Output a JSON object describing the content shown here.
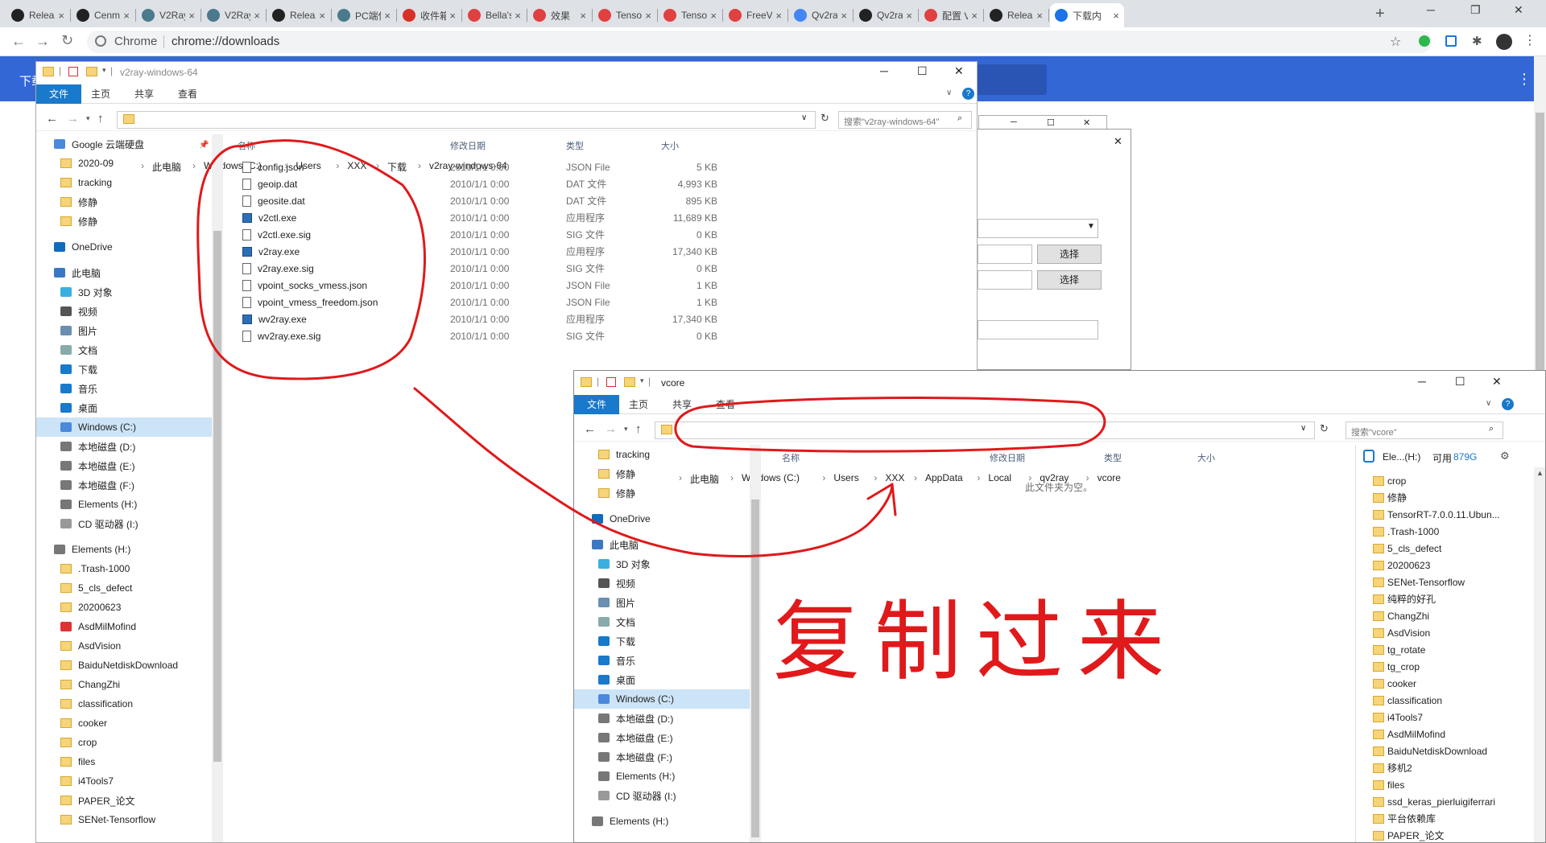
{
  "browser": {
    "tabs": [
      {
        "label": "Releas",
        "icon": "github-icon"
      },
      {
        "label": "Cenm",
        "icon": "github-icon"
      },
      {
        "label": "V2Ray",
        "icon": "page-icon"
      },
      {
        "label": "V2Ray",
        "icon": "page-icon"
      },
      {
        "label": "Releas",
        "icon": "github-icon"
      },
      {
        "label": "PC端使",
        "icon": "page-icon"
      },
      {
        "label": "收件箱",
        "icon": "gmail-icon"
      },
      {
        "label": "Bella's",
        "icon": "app-icon"
      },
      {
        "label": "效果",
        "icon": "app-icon"
      },
      {
        "label": "Tenso",
        "icon": "app-icon"
      },
      {
        "label": "Tenso",
        "icon": "app-icon"
      },
      {
        "label": "FreeV",
        "icon": "app-icon"
      },
      {
        "label": "Qv2ra",
        "icon": "google-icon"
      },
      {
        "label": "Qv2ra",
        "icon": "github-icon"
      },
      {
        "label": "配置 V",
        "icon": "app-icon"
      },
      {
        "label": "Relea",
        "icon": "github-icon"
      },
      {
        "label": "下载内",
        "icon": "download-icon",
        "active": true
      }
    ],
    "omnibox": {
      "site": "Chrome",
      "url": "chrome://downloads"
    }
  },
  "downloads_page": {
    "title": "下载"
  },
  "explorer1": {
    "title": "v2ray-windows-64",
    "ribbon": [
      "文件",
      "主页",
      "共享",
      "查看"
    ],
    "path": [
      "此电脑",
      "Windows (C:)",
      "Users",
      "XXX",
      "下载",
      "v2ray-windows-64"
    ],
    "search_placeholder": "搜索\"v2ray-windows-64\"",
    "nav": [
      {
        "label": "Google 云端硬盘",
        "icon": "drive"
      },
      {
        "label": "2020-09",
        "icon": "folder"
      },
      {
        "label": "tracking",
        "icon": "folder"
      },
      {
        "label": "修静",
        "icon": "folder"
      },
      {
        "label": "修静",
        "icon": "folder"
      },
      {
        "label": "OneDrive",
        "icon": "cloud"
      },
      {
        "label": "此电脑",
        "icon": "pc"
      },
      {
        "label": "3D 对象",
        "icon": "3d"
      },
      {
        "label": "视频",
        "icon": "video"
      },
      {
        "label": "图片",
        "icon": "pic"
      },
      {
        "label": "文档",
        "icon": "doc"
      },
      {
        "label": "下载",
        "icon": "down"
      },
      {
        "label": "音乐",
        "icon": "music"
      },
      {
        "label": "桌面",
        "icon": "desk"
      },
      {
        "label": "Windows (C:)",
        "icon": "drive",
        "selected": true
      },
      {
        "label": "本地磁盘 (D:)",
        "icon": "disk"
      },
      {
        "label": "本地磁盘 (E:)",
        "icon": "disk"
      },
      {
        "label": "本地磁盘 (F:)",
        "icon": "disk"
      },
      {
        "label": "Elements (H:)",
        "icon": "disk"
      },
      {
        "label": "CD 驱动器 (I:)",
        "icon": "cd"
      },
      {
        "label": "Elements (H:)",
        "icon": "disk"
      },
      {
        "label": ".Trash-1000",
        "icon": "folder"
      },
      {
        "label": "5_cls_defect",
        "icon": "folder"
      },
      {
        "label": "20200623",
        "icon": "folder"
      },
      {
        "label": "AsdMilMofind",
        "icon": "app"
      },
      {
        "label": "AsdVision",
        "icon": "folder"
      },
      {
        "label": "BaiduNetdiskDownload",
        "icon": "folder"
      },
      {
        "label": "ChangZhi",
        "icon": "folder"
      },
      {
        "label": "classification",
        "icon": "folder"
      },
      {
        "label": "cooker",
        "icon": "folder"
      },
      {
        "label": "crop",
        "icon": "folder"
      },
      {
        "label": "files",
        "icon": "folder"
      },
      {
        "label": "i4Tools7",
        "icon": "folder"
      },
      {
        "label": "PAPER_论文",
        "icon": "folder"
      },
      {
        "label": "SENet-Tensorflow",
        "icon": "folder"
      }
    ],
    "columns": [
      "名称",
      "修改日期",
      "类型",
      "大小"
    ],
    "files": [
      {
        "name": "config.json",
        "date": "2010/1/1 0:00",
        "type": "JSON File",
        "size": "5 KB",
        "icon": "json"
      },
      {
        "name": "geoip.dat",
        "date": "2010/1/1 0:00",
        "type": "DAT 文件",
        "size": "4,993 KB",
        "icon": "file"
      },
      {
        "name": "geosite.dat",
        "date": "2010/1/1 0:00",
        "type": "DAT 文件",
        "size": "895 KB",
        "icon": "file"
      },
      {
        "name": "v2ctl.exe",
        "date": "2010/1/1 0:00",
        "type": "应用程序",
        "size": "11,689 KB",
        "icon": "exe"
      },
      {
        "name": "v2ctl.exe.sig",
        "date": "2010/1/1 0:00",
        "type": "SIG 文件",
        "size": "0 KB",
        "icon": "file"
      },
      {
        "name": "v2ray.exe",
        "date": "2010/1/1 0:00",
        "type": "应用程序",
        "size": "17,340 KB",
        "icon": "exe"
      },
      {
        "name": "v2ray.exe.sig",
        "date": "2010/1/1 0:00",
        "type": "SIG 文件",
        "size": "0 KB",
        "icon": "file"
      },
      {
        "name": "vpoint_socks_vmess.json",
        "date": "2010/1/1 0:00",
        "type": "JSON File",
        "size": "1 KB",
        "icon": "json"
      },
      {
        "name": "vpoint_vmess_freedom.json",
        "date": "2010/1/1 0:00",
        "type": "JSON File",
        "size": "1 KB",
        "icon": "json"
      },
      {
        "name": "wv2ray.exe",
        "date": "2010/1/1 0:00",
        "type": "应用程序",
        "size": "17,340 KB",
        "icon": "exe"
      },
      {
        "name": "wv2ray.exe.sig",
        "date": "2010/1/1 0:00",
        "type": "SIG 文件",
        "size": "0 KB",
        "icon": "file"
      }
    ]
  },
  "dialog": {
    "button1": "选择",
    "button2": "选择"
  },
  "explorer2": {
    "title": "vcore",
    "ribbon": [
      "文件",
      "主页",
      "共享",
      "查看"
    ],
    "path": [
      "此电脑",
      "Windows (C:)",
      "Users",
      "XXX",
      "AppData",
      "Local",
      "qv2ray",
      "vcore"
    ],
    "search_placeholder": "搜索\"vcore\"",
    "nav": [
      {
        "label": "tracking",
        "icon": "folder"
      },
      {
        "label": "修静",
        "icon": "folder"
      },
      {
        "label": "修静",
        "icon": "folder"
      },
      {
        "label": "OneDrive",
        "icon": "cloud"
      },
      {
        "label": "此电脑",
        "icon": "pc"
      },
      {
        "label": "3D 对象",
        "icon": "3d"
      },
      {
        "label": "视频",
        "icon": "video"
      },
      {
        "label": "图片",
        "icon": "pic"
      },
      {
        "label": "文档",
        "icon": "doc"
      },
      {
        "label": "下载",
        "icon": "down"
      },
      {
        "label": "音乐",
        "icon": "music"
      },
      {
        "label": "桌面",
        "icon": "desk"
      },
      {
        "label": "Windows (C:)",
        "icon": "drive",
        "selected": true
      },
      {
        "label": "本地磁盘 (D:)",
        "icon": "disk"
      },
      {
        "label": "本地磁盘 (E:)",
        "icon": "disk"
      },
      {
        "label": "本地磁盘 (F:)",
        "icon": "disk"
      },
      {
        "label": "Elements (H:)",
        "icon": "disk"
      },
      {
        "label": "CD 驱动器 (I:)",
        "icon": "cd"
      },
      {
        "label": "Elements (H:)",
        "icon": "disk"
      }
    ],
    "columns": [
      "名称",
      "修改日期",
      "类型",
      "大小"
    ],
    "empty_text": "此文件夹为空。",
    "side_header": {
      "drive": "Ele...(H:)",
      "free_label": "可用",
      "free_value": "879G"
    },
    "side_items": [
      "crop",
      "修静",
      "TensorRT-7.0.0.11.Ubun...",
      ".Trash-1000",
      "5_cls_defect",
      "20200623",
      "SENet-Tensorflow",
      "纯粹的好孔",
      "ChangZhi",
      "AsdVision",
      "tg_rotate",
      "tg_crop",
      "cooker",
      "classification",
      "i4Tools7",
      "AsdMilMofind",
      "BaiduNetdiskDownload",
      "移机2",
      "files",
      "ssd_keras_pierluigiferrari",
      "平台依赖库",
      "PAPER_论文"
    ]
  },
  "annotation": {
    "text": "复制过来",
    "color": "#e0191b"
  }
}
